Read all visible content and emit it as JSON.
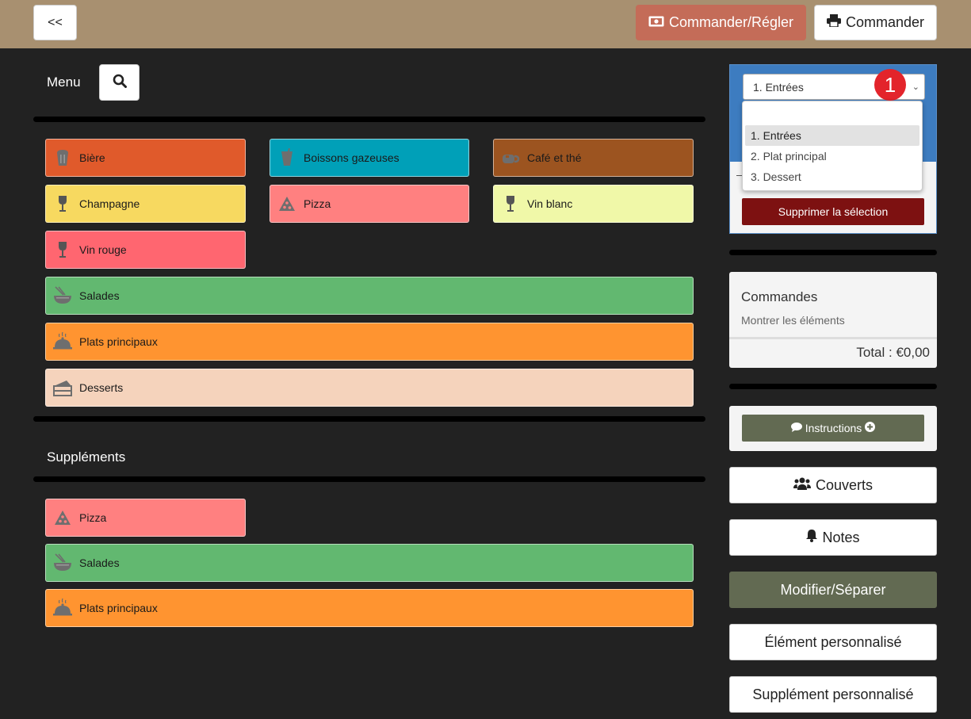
{
  "header": {
    "back_label": "<<",
    "pay_label": "Commander/Régler",
    "order_label": "Commander",
    "bg": "#a89070"
  },
  "menu": {
    "title": "Menu",
    "categories": [
      {
        "label": "Bière",
        "color": "#e05a2b",
        "icon": "beer-icon"
      },
      {
        "label": "Boissons gazeuses",
        "color": "#00a0b8",
        "icon": "soda-icon"
      },
      {
        "label": "Café et thé",
        "color": "#9c5420",
        "icon": "coffee-icon"
      },
      {
        "label": "Champagne",
        "color": "#f7d960",
        "icon": "wine-glass-icon"
      },
      {
        "label": "Pizza",
        "color": "#ff8080",
        "icon": "pizza-icon"
      },
      {
        "label": "Vin blanc",
        "color": "#f0f8a8",
        "icon": "wine-glass-icon"
      },
      {
        "label": "Vin rouge",
        "color": "#ff6670",
        "icon": "wine-glass-icon"
      },
      {
        "label": "Salades",
        "color": "#62b870",
        "icon": "bowl-icon"
      },
      {
        "label": "Plats principaux",
        "color": "#ff9430",
        "icon": "cloche-icon"
      },
      {
        "label": "Desserts",
        "color": "#f5d3bc",
        "icon": "cake-icon"
      }
    ]
  },
  "supplements": {
    "title": "Suppléments",
    "categories": [
      {
        "label": "Pizza",
        "color": "#ff8080",
        "icon": "pizza-icon"
      },
      {
        "label": "Salades",
        "color": "#62b870",
        "icon": "bowl-icon"
      },
      {
        "label": "Plats principaux",
        "color": "#ff9430",
        "icon": "cloche-icon"
      }
    ]
  },
  "course": {
    "selected": "1. Entrées",
    "badge": "1",
    "options": [
      "1. Entrées",
      "2. Plat principal",
      "3. Dessert"
    ],
    "delete_label": "Supprimer la sélection"
  },
  "orders": {
    "title": "Commandes",
    "show_items": "Montrer les éléments",
    "total": "Total : €0,00"
  },
  "actions": {
    "instructions": "Instructions",
    "covers": "Couverts",
    "notes": "Notes",
    "modify": "Modifier/Séparer",
    "custom_item": "Élément personnalisé",
    "custom_supplement": "Supplément personnalisé"
  }
}
